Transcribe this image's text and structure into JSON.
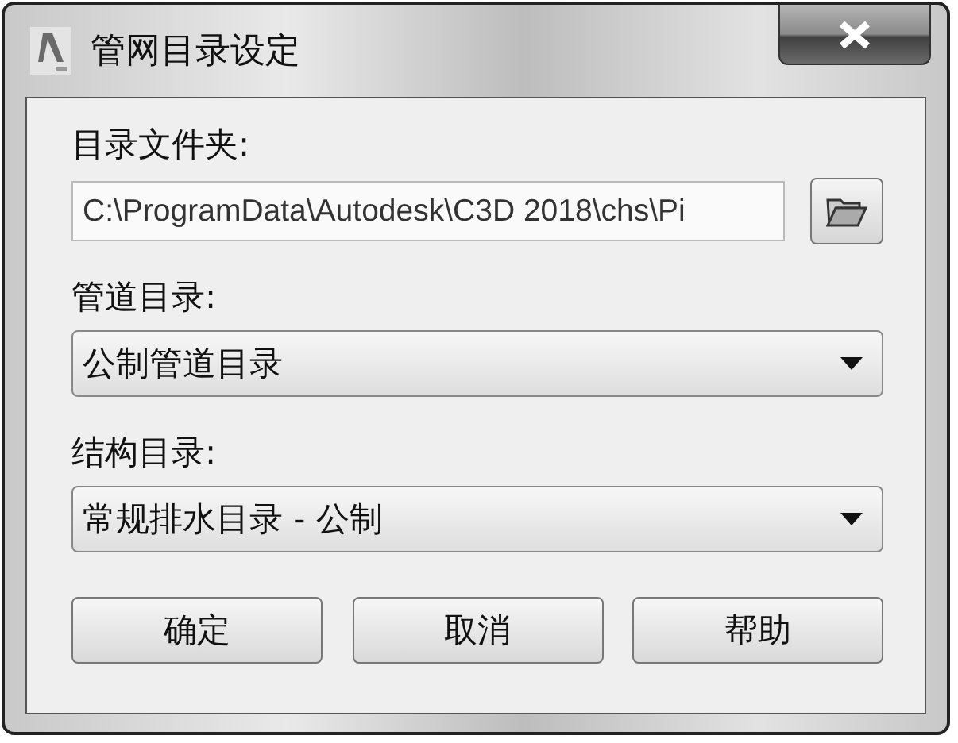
{
  "window": {
    "title": "管网目录设定"
  },
  "fields": [
    {
      "kind": "path",
      "label": "目录文件夹:",
      "value": "C:\\ProgramData\\Autodesk\\C3D 2018\\chs\\Pi"
    },
    {
      "kind": "dropdown",
      "label": "管道目录:",
      "value": "公制管道目录"
    },
    {
      "kind": "dropdown",
      "label": "结构目录:",
      "value": "常规排水目录 - 公制"
    }
  ],
  "buttons": [
    "确定",
    "取消",
    "帮助"
  ]
}
